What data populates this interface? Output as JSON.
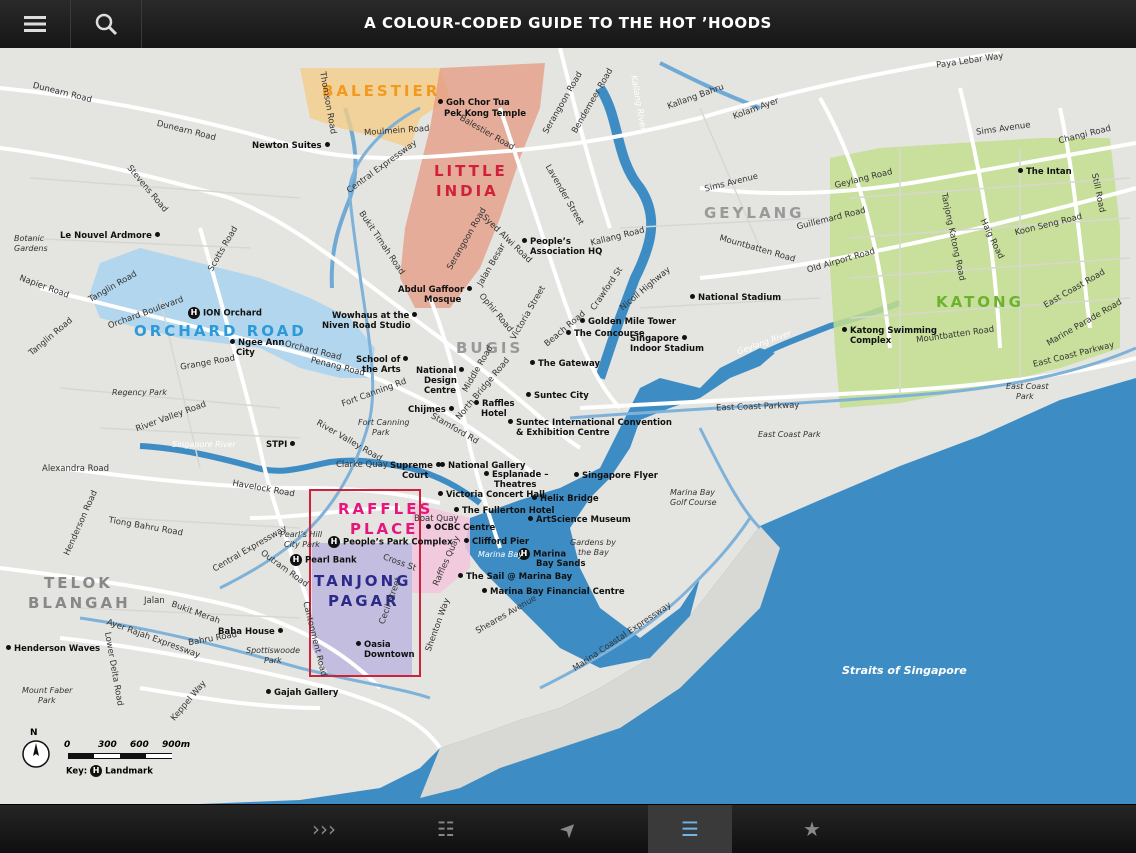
{
  "header": {
    "title": "A COLOUR-CODED GUIDE TO THE HOT ’HOODS",
    "menu_icon": "hamburger-icon",
    "search_icon": "search-icon"
  },
  "colors": {
    "water": "#3d8dc4",
    "land": "#e4e4e1",
    "balestier": "#f4cd8a",
    "little_india": "#e49a80",
    "orchard": "#a9d3ef",
    "katong": "#c3df8f",
    "raffles_place": "#f3c6dc",
    "tanjong_pagar": "#bdb7de",
    "highlight_box": "#d0213c",
    "active_tab": "#6fb5e8"
  },
  "neighbourhoods": {
    "balestier": "BALESTIER",
    "little_india_1": "LITTLE",
    "little_india_2": "INDIA",
    "orchard": "ORCHARD ROAD",
    "bugis": "BUGIS",
    "geylang": "GEYLANG",
    "katong": "KATONG",
    "raffles_1": "RAFFLES",
    "raffles_2": "PLACE",
    "tanjong_1": "TANJONG",
    "tanjong_2": "PAGAR",
    "telok_1": "TELOK",
    "telok_2": "BLANGAH"
  },
  "places": {
    "goh_chor_tua": "Goh Chor Tua",
    "goh_chor_tua_2": "Pek Kong Temple",
    "newton_suites": "Newton Suites",
    "le_nouvel": "Le Nouvel Ardmore",
    "ion": "ION Orchard",
    "ngee_ann": "Ngee Ann",
    "ngee_ann_2": "City",
    "wowhaus": "Wowhaus at the",
    "wowhaus_2": "Niven Road Studio",
    "school_arts": "School of",
    "school_arts_2": "the Arts",
    "ndc": "National",
    "ndc_2": "Design",
    "ndc_3": "Centre",
    "chijmes": "Chijmes",
    "raffles_hotel": "Raffles",
    "raffles_hotel_2": "Hotel",
    "abdul_gaffoor": "Abdul Gaffoor",
    "abdul_gaffoor_2": "Mosque",
    "peoples_assoc": "People’s",
    "peoples_assoc_2": "Association HQ",
    "golden_mile": "Golden Mile Tower",
    "concourse": "The Concourse",
    "indoor_stadium": "Singapore",
    "indoor_stadium_2": "Indoor Stadium",
    "national_stadium": "National Stadium",
    "the_intan": "The Intan",
    "katong_swimming": "Katong Swimming",
    "katong_swimming_2": "Complex",
    "the_gateway": "The Gateway",
    "suntec_city": "Suntec City",
    "suntec_cc": "Suntec International Convention",
    "suntec_cc_2": "& Exhibition Centre",
    "stpi": "STPI",
    "supreme_court": "Supreme",
    "supreme_court_2": "Court",
    "national_gallery": "National Gallery",
    "esplanade": "Esplanade –",
    "esplanade_2": "Theatres",
    "singapore_flyer": "Singapore Flyer",
    "victoria_hall": "Victoria Concert Hall",
    "helix": "Helix Bridge",
    "fullerton": "The Fullerton Hotel",
    "artscience": "ArtScience Museum",
    "ocbc": "OCBC Centre",
    "clifford": "Clifford Pier",
    "mbs": "Marina",
    "mbs_2": "Bay Sands",
    "peoples_park": "People’s Park Complex",
    "pearl_bank": "Pearl Bank",
    "sail": "The Sail @ Marina Bay",
    "mbfc": "Marina Bay Financial Centre",
    "baba_house": "Baba House",
    "oasia": "Oasia",
    "oasia_2": "Downtown",
    "henderson_waves": "Henderson Waves",
    "gajah": "Gajah Gallery"
  },
  "roads": {
    "dunearn_1": "Dunearn Road",
    "dunearn_2": "Dunearn Road",
    "thomson": "Thomson Road",
    "moulmein": "Moulmein Road",
    "balestier_rd": "Balestier Road",
    "serangoon": "Serangoon Road",
    "bendemeer": "Bendemeer Road",
    "kallang_bahru": "Kallang Bahru",
    "kolam_ayer": "Kolam Ayer",
    "paya_lebar": "Paya Lebar Way",
    "sims_ave": "Sims Avenue",
    "sims_ave_2": "Sims Avenue",
    "changi": "Changi Road",
    "geylang_rd": "Geylang Road",
    "guillemard": "Guillemard Road",
    "still_rd": "Still Road",
    "tanjong_katong": "Tanjong Katong Road",
    "haig": "Haig Road",
    "koon_seng": "Koon Seng Road",
    "old_airport": "Old Airport Road",
    "mountbatten": "Mountbatten Road",
    "mountbatten_2": "Mountbatten Road",
    "east_coast_rd": "East Coast Road",
    "marine_parade": "Marine Parade Road",
    "ecp_1": "East Coast Parkway",
    "ecp_2": "East Coast Parkway",
    "stevens": "Stevens Road",
    "cte": "Central Expressway",
    "kallang_rd": "Kallang Road",
    "lavender": "Lavender Street",
    "bukit_timah": "Bukit Timah Road",
    "serangoon_2": "Serangoon Road",
    "syed_alwi": "Syed Alwi Road",
    "jalan_besar": "Jalan Besar",
    "crawford": "Crawford St",
    "nicoll": "Nicoll Highway",
    "scotts": "Scotts Road",
    "napier": "Napier Road",
    "tanglin": "Tanglin Road",
    "orchard_blvd": "Orchard Boulevard",
    "tanglin_2": "Tanglin Road",
    "orchard_rd": "Orchard Road",
    "penang": "Penang Road",
    "grange": "Grange Road",
    "fort_canning_rd": "Fort Canning Rd",
    "ophir": "Ophir Road",
    "victoria_st": "Victoria Street",
    "beach": "Beach Road",
    "middle": "Middle Road",
    "north_bridge": "North Bridge Road",
    "stamford": "Stamford Rd",
    "river_valley": "River Valley Road",
    "river_valley_2": "River Valley Road",
    "clarke_quay": "Clarke Quay",
    "alexandra": "Alexandra Road",
    "havelock": "Havelock Road",
    "tiong_bahru": "Tiong Bahru Road",
    "henderson": "Henderson Road",
    "outram": "Outram Road",
    "cte_2": "Central Expressway",
    "jalan_bukit_merah": "Jalan",
    "bukit_merah": "Bukit Merah",
    "bahru": "Bahru Road",
    "ayer_rajah": "Ayer Rajah Expressway",
    "lower_delta": "Lower Delta Road",
    "keppel": "Keppel Way",
    "cantonment": "Cantonment Road",
    "cecil": "Cecil Street",
    "cross": "Cross St",
    "boat_quay": "Boat Quay",
    "raffles_quay": "Raffles Quay",
    "shenton": "Shenton Way",
    "sheares": "Sheares Avenue",
    "mce": "Marina Coastal Expressway",
    "kallang_river": "Kallang River",
    "geylang_river": "Geylang River",
    "singapore_river": "Singapore River",
    "marina_bay": "Marina Bay",
    "straits": "Straits of Singapore"
  },
  "parks": {
    "botanic": "Botanic",
    "botanic_2": "Gardens",
    "regency": "Regency Park",
    "fort_canning": "Fort Canning",
    "fort_canning_2": "Park",
    "spottiswoode": "Spottiswoode",
    "spottiswoode_2": "Park",
    "mount_faber": "Mount Faber",
    "mount_faber_2": "Park",
    "pearls_hill": "Pearl’s Hill",
    "pearls_hill_2": "City Park",
    "gardens_bay": "Gardens by",
    "gardens_bay_2": "the Bay",
    "mb_golf": "Marina Bay",
    "mb_golf_2": "Golf Course",
    "ec_park": "East Coast",
    "ec_park_2": "Park",
    "ec_park_3": "East Coast Park"
  },
  "scale": {
    "north": "N",
    "ticks": [
      "0",
      "300",
      "600",
      "900m"
    ],
    "key_label": "Key:",
    "key_item": "Landmark",
    "landmark_glyph": "H"
  },
  "tabs": [
    {
      "icon": "chevron-triple-icon",
      "glyph": "›››"
    },
    {
      "icon": "grid-icon",
      "glyph": "☷"
    },
    {
      "icon": "navigation-arrow-icon",
      "glyph": "➤"
    },
    {
      "icon": "list-icon",
      "glyph": "☰"
    },
    {
      "icon": "star-icon",
      "glyph": "★"
    }
  ]
}
